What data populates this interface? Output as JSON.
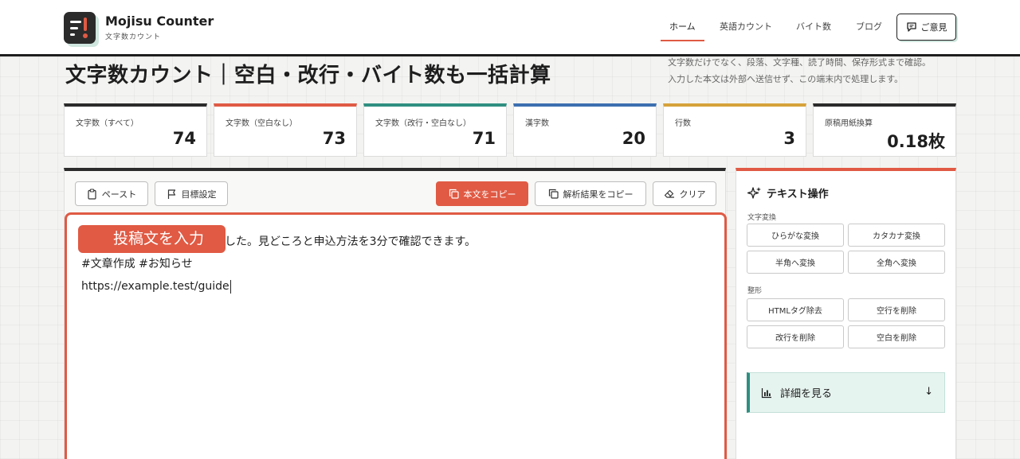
{
  "brand": {
    "name": "Mojisu Counter",
    "subtitle": "文字数カウント"
  },
  "nav": {
    "items": [
      "ホーム",
      "英語カウント",
      "バイト数",
      "ブログ"
    ],
    "feedback": "ご意見"
  },
  "page": {
    "title": "文字数カウント｜空白・改行・バイト数も一括計算",
    "desc_lines": [
      "文字数だけでなく、段落、文字種、読了時間、保存形式まで確認。",
      "入力した本文は外部へ送信せず、この端末内で処理します。"
    ]
  },
  "stats": [
    {
      "label": "文字数（すべて）",
      "value": "74",
      "color": "#2b2b2b"
    },
    {
      "label": "文字数（空白なし）",
      "value": "73",
      "color": "#e05a44"
    },
    {
      "label": "文字数（改行・空白なし）",
      "value": "71",
      "color": "#2f8f80"
    },
    {
      "label": "漢字数",
      "value": "20",
      "color": "#3d6fb0"
    },
    {
      "label": "行数",
      "value": "3",
      "color": "#d6a23a"
    },
    {
      "label": "原稿用紙換算",
      "value": "0.18枚",
      "color": "#2b2b2b"
    }
  ],
  "toolbar": {
    "paste": "ペースト",
    "goal": "目標設定",
    "copy_text": "本文をコピー",
    "copy_results": "解析結果をコピー",
    "clear": "クリア"
  },
  "editor": {
    "placeholder_tag": "投稿文を入力",
    "lines": [
      "した。見どころと申込方法を3分で確認できます。",
      "#文章作成 #お知らせ",
      "https://example.test/guide"
    ]
  },
  "side": {
    "title": "テキスト操作",
    "section_convert": "文字変換",
    "convert_buttons": [
      "ひらがな変換",
      "カタカナ変換",
      "半角へ変換",
      "全角へ変換"
    ],
    "section_format": "整形",
    "format_buttons": [
      "HTMLタグ除去",
      "空行を削除",
      "改行を削除",
      "空白を削除"
    ],
    "details": "詳細を見る",
    "details_arrow": "↓"
  }
}
